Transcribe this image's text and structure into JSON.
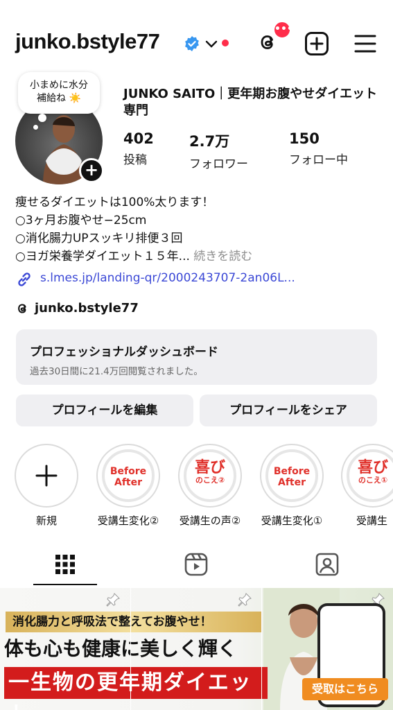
{
  "header": {
    "username": "junko.bstyle77",
    "threads_badge": "•••"
  },
  "profile": {
    "note_line1": "小まめに水分",
    "note_line2": "補給ね ☀️",
    "display_name": "JUNKO SAITO｜更年期お腹やせダイエット専門",
    "stats": [
      {
        "num": "402",
        "label": "投稿"
      },
      {
        "num": "2.7万",
        "label": "フォロワー"
      },
      {
        "num": "150",
        "label": "フォロー中"
      }
    ],
    "bio_lines": [
      "痩せるダイエットは100%太ります！",
      "○3ヶ月お腹やせ−25cm",
      "○消化腸力UPスッキリ排便３回"
    ],
    "bio_last": "○ヨガ栄養学ダイエット１５年...",
    "bio_more": "続きを読む",
    "link": "s.lmes.jp/landing-qr/2000243707-2an06L...",
    "threads_handle": "junko.bstyle77"
  },
  "dashboard": {
    "title": "プロフェッショナルダッシュボード",
    "subtitle": "過去30日間に21.4万回閲覧されました。"
  },
  "buttons": {
    "edit": "プロフィールを編集",
    "share": "プロフィールをシェア"
  },
  "highlights": [
    {
      "label": "新規"
    },
    {
      "label": "受講生変化②",
      "cover": "Before\nAfter"
    },
    {
      "label": "受講生の声②",
      "cover_main": "喜び",
      "cover_sub": "のこえ②"
    },
    {
      "label": "受講生変化①",
      "cover": "Before\nAfter"
    },
    {
      "label": "受講生",
      "cover_main": "喜び",
      "cover_sub": "のこえ①"
    }
  ],
  "grid_post": {
    "line1": "消化腸力と呼吸法で整えてお腹やせ！",
    "line2": "体も心も健康に美しく輝く",
    "line3": "一生物の更年期ダイエット",
    "cta": "受取はこちら"
  },
  "colors": {
    "accent_red": "#ff2d4a",
    "link_blue": "#3b48d6",
    "verified_blue": "#3897f0"
  }
}
